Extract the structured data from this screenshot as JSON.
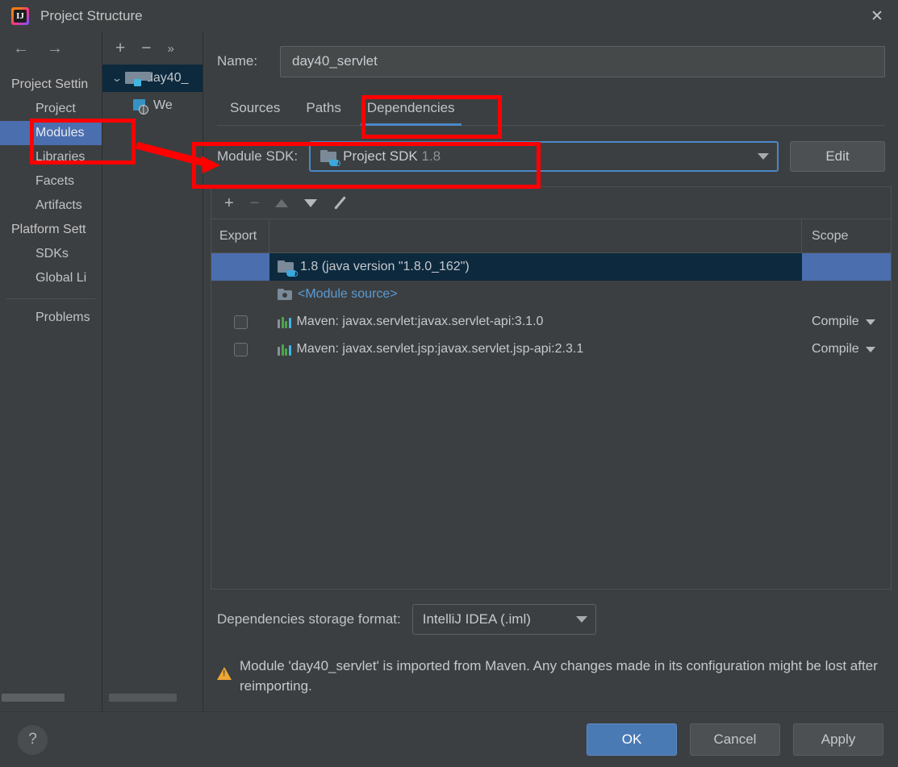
{
  "window": {
    "title": "Project Structure",
    "app_icon": "intellij-idea-icon",
    "close_icon": "✕"
  },
  "sidebar": {
    "nav": {
      "back_icon": "←",
      "forward_icon": "→"
    },
    "groups": [
      {
        "label": "Project Settin",
        "items": [
          {
            "label": "Project",
            "selected": false
          },
          {
            "label": "Modules",
            "selected": true
          },
          {
            "label": "Libraries",
            "selected": false
          },
          {
            "label": "Facets",
            "selected": false
          },
          {
            "label": "Artifacts",
            "selected": false
          }
        ]
      },
      {
        "label": "Platform Sett",
        "items": [
          {
            "label": "SDKs",
            "selected": false
          },
          {
            "label": "Global Li",
            "selected": false
          }
        ]
      }
    ],
    "problems": {
      "label": "Problems"
    }
  },
  "tree": {
    "toolbar": {
      "add": "+",
      "remove": "−",
      "more": "»"
    },
    "nodes": [
      {
        "label": "day40_",
        "icon": "module-icon",
        "selected": true,
        "expand_icon": "chevron-down-icon"
      },
      {
        "label": "We",
        "icon": "web-facet-icon",
        "selected": false
      }
    ]
  },
  "main": {
    "name": {
      "label": "Name:",
      "value": "day40_servlet"
    },
    "tabs": [
      {
        "label": "Sources",
        "active": false
      },
      {
        "label": "Paths",
        "active": false
      },
      {
        "label": "Dependencies",
        "active": true
      }
    ],
    "module_sdk": {
      "label": "Module SDK:",
      "value_main": "Project SDK",
      "value_version": "1.8",
      "icon": "sdk-folder-java-icon",
      "dropdown_icon": "chevron-down-icon",
      "edit_button": "Edit"
    },
    "dep_toolbar": {
      "add_icon": "+",
      "remove_icon": "−",
      "move_up_icon": "triangle-up-icon",
      "move_down_icon": "triangle-down-icon",
      "edit_icon": "pencil-icon"
    },
    "table": {
      "columns": [
        "Export",
        "",
        "Scope"
      ],
      "rows": [
        {
          "export": "none",
          "icon": "sdk-folder-java-icon",
          "name": "1.8 (java version \"1.8.0_162\")",
          "scope": "",
          "selected": true,
          "link": false
        },
        {
          "export": "none",
          "icon": "module-source-icon",
          "name": "<Module source>",
          "scope": "",
          "selected": false,
          "link": true
        },
        {
          "export": "unchecked",
          "icon": "maven-library-icon",
          "name": "Maven: javax.servlet:javax.servlet-api:3.1.0",
          "scope": "Compile",
          "selected": false,
          "link": false
        },
        {
          "export": "unchecked",
          "icon": "maven-library-icon",
          "name": "Maven: javax.servlet.jsp:javax.servlet.jsp-api:2.3.1",
          "scope": "Compile",
          "selected": false,
          "link": false
        }
      ]
    },
    "storage": {
      "label": "Dependencies storage format:",
      "value": "IntelliJ IDEA (.iml)",
      "dropdown_icon": "chevron-down-icon"
    },
    "warning": {
      "icon": "warning-triangle-icon",
      "text": "Module 'day40_servlet' is imported from Maven. Any changes made in its configuration might be lost after reimporting."
    }
  },
  "footer": {
    "help_icon": "?",
    "ok": "OK",
    "cancel": "Cancel",
    "apply": "Apply"
  },
  "colors": {
    "accent_blue": "#4a88c7",
    "selection_blue": "#4b6eaf",
    "annotation_red": "#ff0000",
    "warning_orange": "#f0a732",
    "link_blue": "#5b9bd5"
  }
}
